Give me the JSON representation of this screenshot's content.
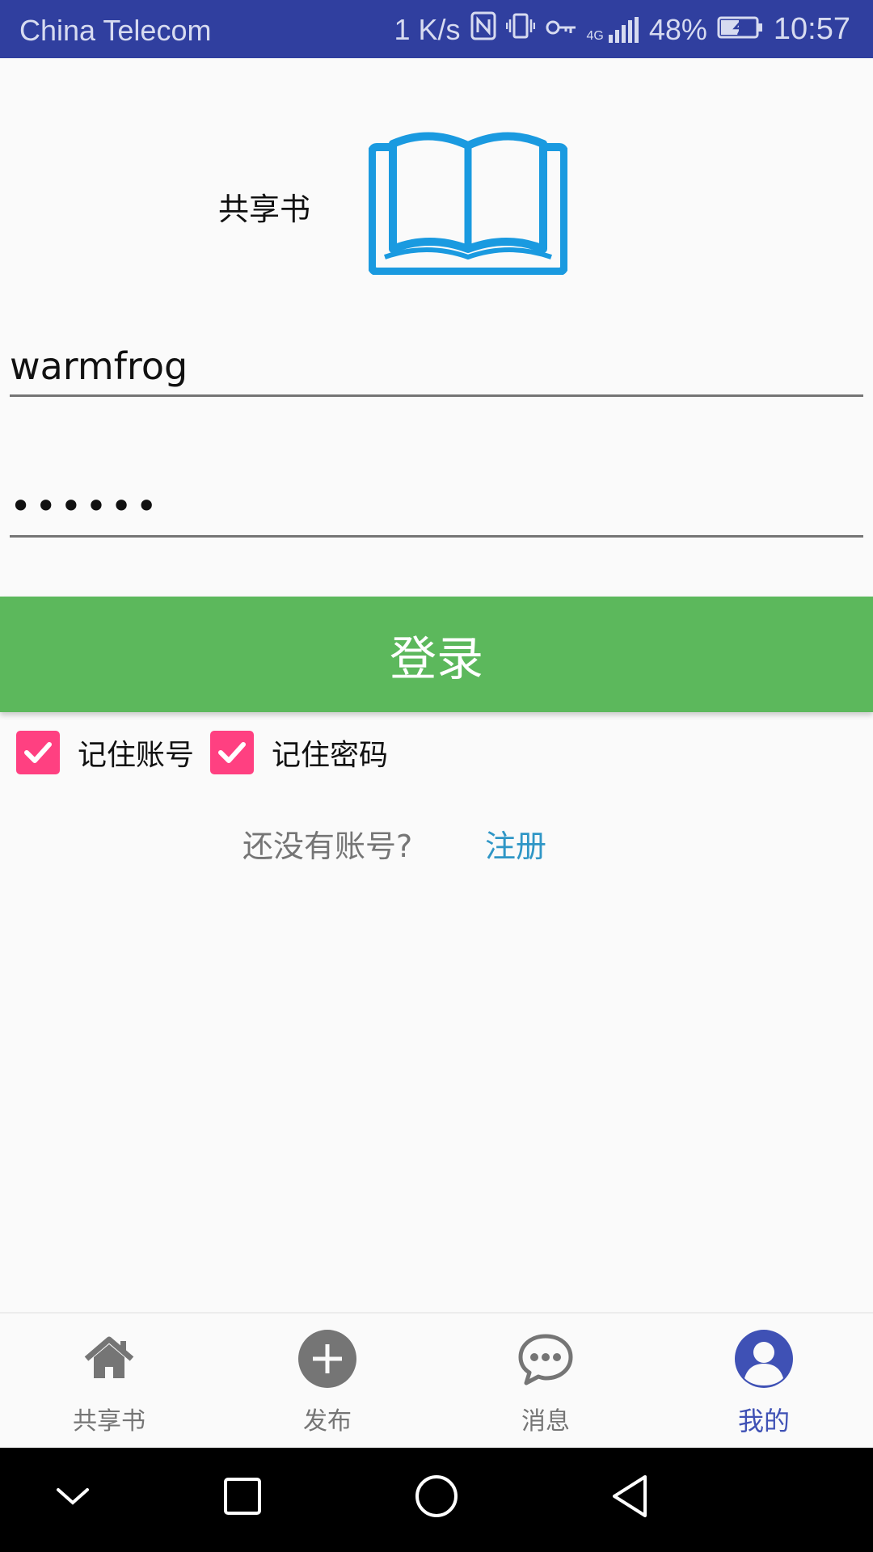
{
  "status_bar": {
    "carrier": "China Telecom",
    "speed": "1 K/s",
    "network": "4G",
    "battery": "48%",
    "time": "10:57",
    "icons": [
      "nfc-icon",
      "vibrate-icon",
      "key-icon",
      "signal-icon",
      "battery-charging-icon"
    ]
  },
  "header": {
    "title": "共享书",
    "logo_icon": "book-icon",
    "logo_color": "#1a9ae0"
  },
  "login_form": {
    "username_value": "warmfrog",
    "password_value": "••••••",
    "login_label": "登录",
    "remember_account_label": "记住账号",
    "remember_account_checked": true,
    "remember_password_label": "记住密码",
    "remember_password_checked": true,
    "no_account_text": "还没有账号?",
    "register_label": "注册"
  },
  "bottom_nav": {
    "items": [
      {
        "label": "共享书",
        "icon": "home-icon",
        "active": false
      },
      {
        "label": "发布",
        "icon": "add-circle-icon",
        "active": false
      },
      {
        "label": "消息",
        "icon": "chat-icon",
        "active": false
      },
      {
        "label": "我的",
        "icon": "profile-icon",
        "active": true
      }
    ]
  },
  "system_nav": [
    "chevron-down-icon",
    "recents-square-icon",
    "home-circle-icon",
    "back-triangle-icon"
  ],
  "colors": {
    "status_bar": "#303f9f",
    "login_button": "#5cb85c",
    "checkbox": "#ff4081",
    "link": "#2f96c6",
    "active_tab": "#3f51b5"
  }
}
